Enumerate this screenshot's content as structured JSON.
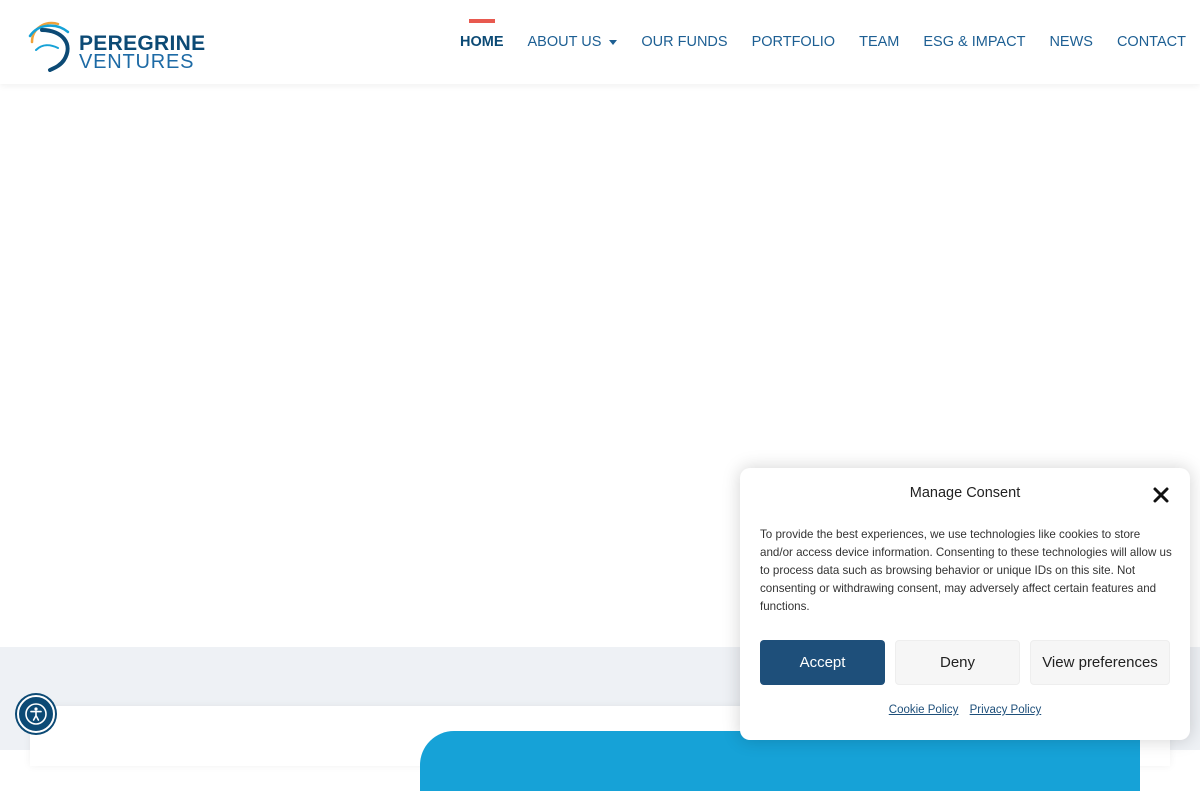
{
  "brand": {
    "name_line1": "PEREGRINE",
    "name_line2": "VENTURES",
    "colors": {
      "navy": "#0c4a75",
      "blue": "#1d5f93",
      "accent_red": "#e8594f",
      "cyan": "#16a2d7",
      "orange": "#f0a23a"
    }
  },
  "nav": {
    "items": [
      {
        "label": "HOME",
        "active": true
      },
      {
        "label": "ABOUT US",
        "has_dropdown": true
      },
      {
        "label": "OUR FUNDS"
      },
      {
        "label": "PORTFOLIO"
      },
      {
        "label": "TEAM"
      },
      {
        "label": "ESG & IMPACT"
      },
      {
        "label": "NEWS"
      },
      {
        "label": "CONTACT"
      }
    ]
  },
  "accessibility": {
    "icon": "accessibility-icon"
  },
  "consent": {
    "title": "Manage Consent",
    "close_icon": "close-icon",
    "body": "To provide the best experiences, we use technologies like cookies to store and/or access device information. Consenting to these technologies will allow us to process data such as browsing behavior or unique IDs on this site. Not consenting or withdrawing consent, may adversely affect certain features and functions.",
    "accept_label": "Accept",
    "deny_label": "Deny",
    "preferences_label": "View preferences",
    "cookie_policy_label": "Cookie Policy",
    "privacy_policy_label": "Privacy Policy"
  }
}
